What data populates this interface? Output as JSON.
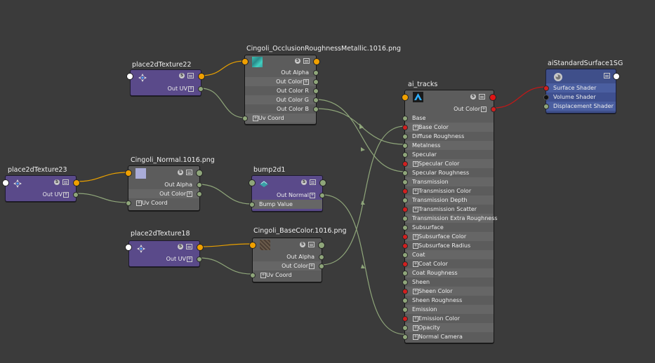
{
  "nodes": {
    "p22": {
      "title": "place2dTexture22",
      "out": "Out UV",
      "sbtn": "S"
    },
    "occ": {
      "title": "Cingoli_OcclusionRoughnessMetallic.1016.png",
      "rows": [
        "Out Alpha",
        "Out Color",
        "Out Color R",
        "Out Color G",
        "Out Color B"
      ],
      "uv": "Uv Coord",
      "sbtn": "S"
    },
    "p23": {
      "title": "place2dTexture23",
      "out": "Out UV",
      "sbtn": "S"
    },
    "normal": {
      "title": "Cingoli_Normal.1016.png",
      "rows": [
        "Out Alpha",
        "Out Color"
      ],
      "uv": "Uv Coord",
      "sbtn": "S"
    },
    "bump": {
      "title": "bump2d1",
      "out": "Out Normal",
      "in": "Bump Value",
      "sbtn": "S"
    },
    "p18": {
      "title": "place2dTexture18",
      "out": "Out UV",
      "sbtn": "S"
    },
    "base": {
      "title": "Cingoli_BaseColor.1016.png",
      "rows": [
        "Out Alpha",
        "Out Color"
      ],
      "uv": "Uv Coord",
      "sbtn": "S"
    },
    "ai": {
      "title": "ai_tracks",
      "out": "Out Color",
      "sbtn": "S",
      "attrs": [
        "Base",
        "Base Color",
        "Diffuse Roughness",
        "Metalness",
        "Specular",
        "Specular Color",
        "Specular Roughness",
        "Transmission",
        "Transmission Color",
        "Transmission Depth",
        "Transmission Scatter",
        "Transmission Extra Roughness",
        "Subsurface",
        "Subsurface Color",
        "Subsurface Radius",
        "Coat",
        "Coat Color",
        "Coat Roughness",
        "Sheen",
        "Sheen Color",
        "Sheen Roughness",
        "Emission",
        "Emission Color",
        "Opacity",
        "Normal Camera"
      ]
    },
    "sg": {
      "title": "aiStandardSurface1SG",
      "rows": [
        "Surface Shader",
        "Volume Shader",
        "Displacement Shader"
      ]
    }
  },
  "colors": {
    "background": "#3b3b3b",
    "wire_green": "#8fa67a",
    "wire_orange": "#e8a000",
    "wire_red": "#c41818",
    "port_red": "#d21f1f"
  }
}
